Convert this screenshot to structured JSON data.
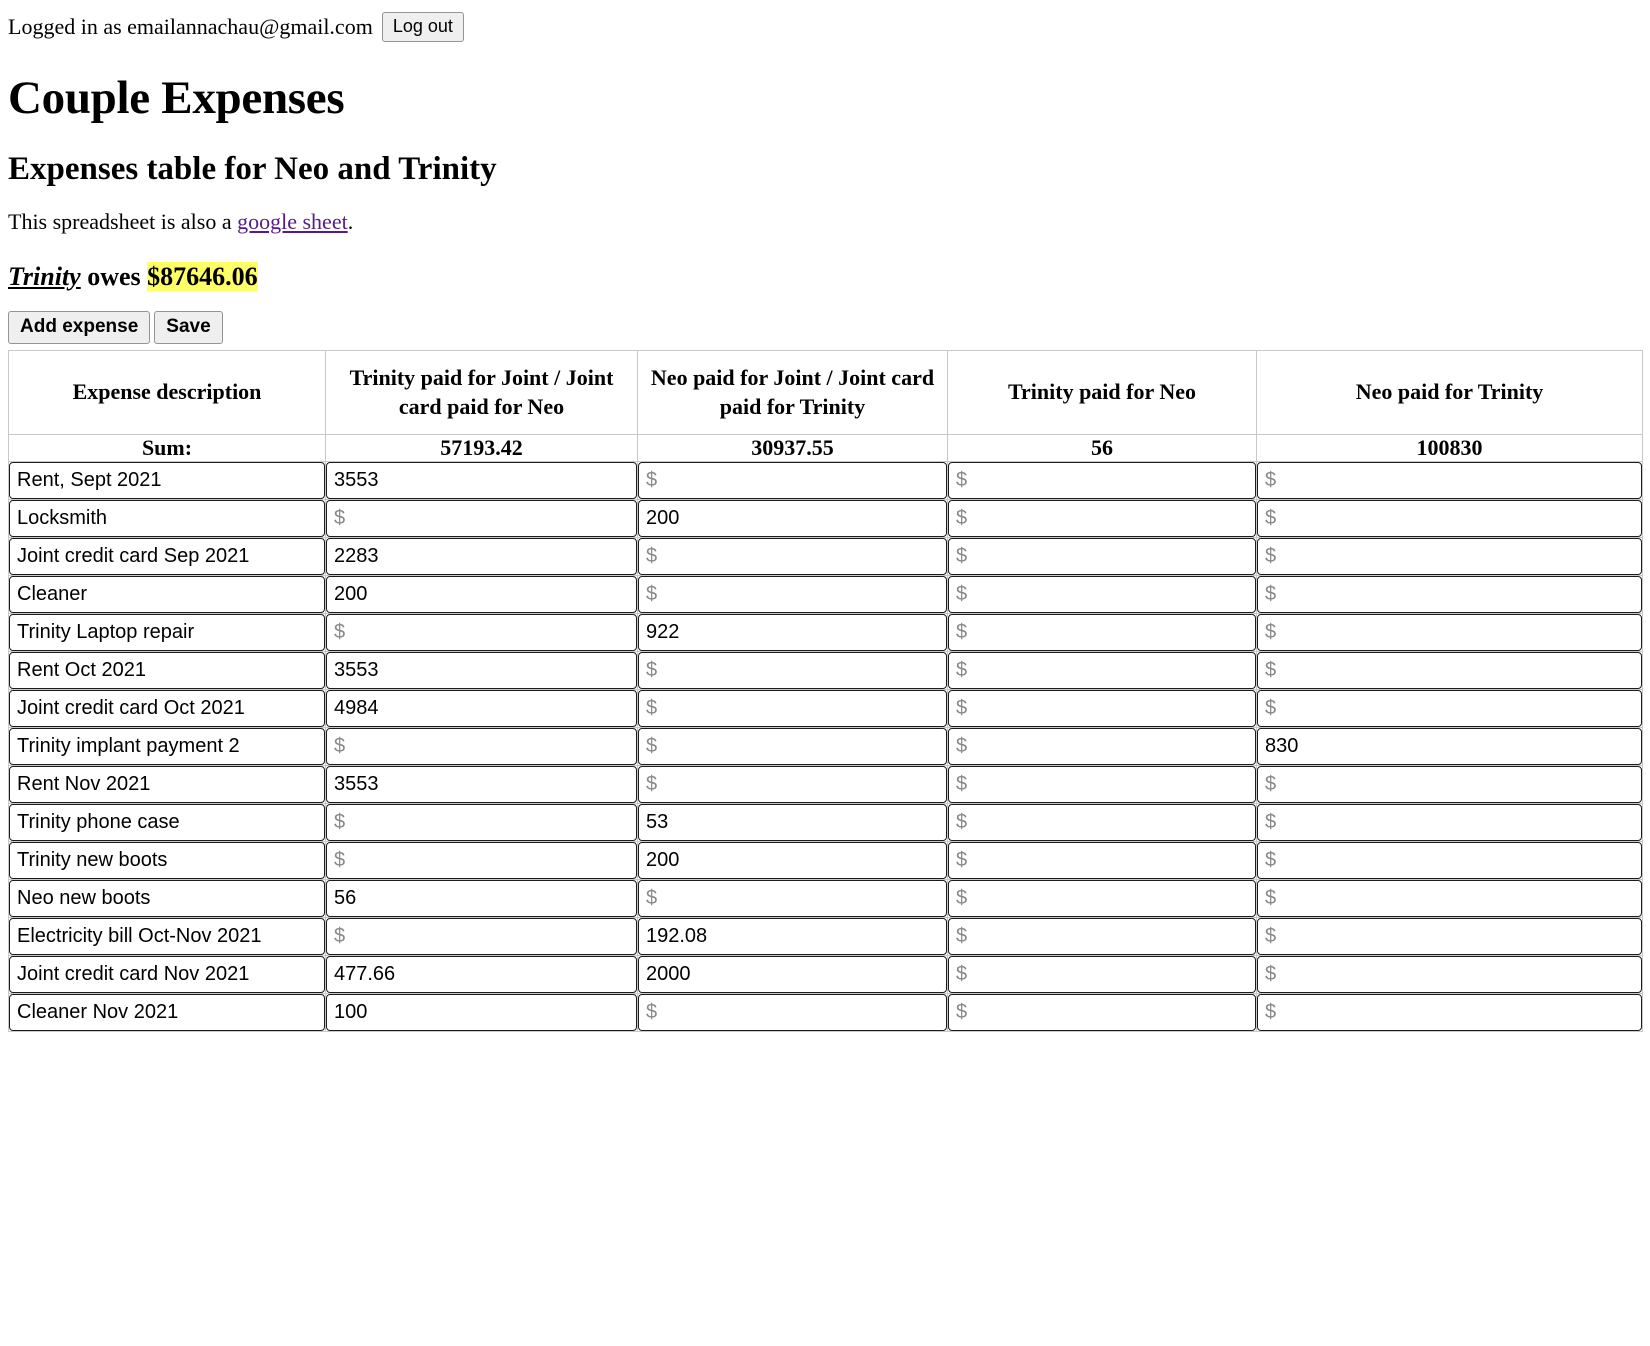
{
  "auth": {
    "logged_in_text": "Logged in as emailannachau@gmail.com",
    "logout_label": "Log out"
  },
  "header": {
    "title": "Couple Expenses",
    "subtitle": "Expenses table for Neo and Trinity"
  },
  "note": {
    "before": "This spreadsheet is also a ",
    "link_text": "google sheet",
    "after": "."
  },
  "balance": {
    "who": "Trinity",
    "verb": " owes ",
    "amount": "$87646.06",
    "highlight_color": "#ffff66"
  },
  "toolbar": {
    "add_label": "Add expense",
    "save_label": "Save"
  },
  "table": {
    "columns": [
      "Expense description",
      "Trinity paid for Joint / Joint card paid for Neo",
      "Neo paid for Joint / Joint card paid for Trinity",
      "Trinity paid for Neo",
      "Neo paid for Trinity"
    ],
    "sum_label": "Sum:",
    "sums": [
      "57193.42",
      "30937.55",
      "56",
      "100830"
    ],
    "amount_placeholder": "$",
    "rows": [
      {
        "description": "Rent, Sept 2021",
        "trinity_joint": "3553",
        "neo_joint": "",
        "trinity_for_neo": "",
        "neo_for_trinity": ""
      },
      {
        "description": "Locksmith",
        "trinity_joint": "",
        "neo_joint": "200",
        "trinity_for_neo": "",
        "neo_for_trinity": ""
      },
      {
        "description": "Joint credit card Sep 2021",
        "trinity_joint": "2283",
        "neo_joint": "",
        "trinity_for_neo": "",
        "neo_for_trinity": ""
      },
      {
        "description": "Cleaner",
        "trinity_joint": "200",
        "neo_joint": "",
        "trinity_for_neo": "",
        "neo_for_trinity": ""
      },
      {
        "description": "Trinity Laptop repair",
        "trinity_joint": "",
        "neo_joint": "922",
        "trinity_for_neo": "",
        "neo_for_trinity": ""
      },
      {
        "description": "Rent Oct 2021",
        "trinity_joint": "3553",
        "neo_joint": "",
        "trinity_for_neo": "",
        "neo_for_trinity": ""
      },
      {
        "description": "Joint credit card Oct 2021",
        "trinity_joint": "4984",
        "neo_joint": "",
        "trinity_for_neo": "",
        "neo_for_trinity": ""
      },
      {
        "description": "Trinity implant payment 2",
        "trinity_joint": "",
        "neo_joint": "",
        "trinity_for_neo": "",
        "neo_for_trinity": "830"
      },
      {
        "description": "Rent Nov 2021",
        "trinity_joint": "3553",
        "neo_joint": "",
        "trinity_for_neo": "",
        "neo_for_trinity": ""
      },
      {
        "description": "Trinity phone case",
        "trinity_joint": "",
        "neo_joint": "53",
        "trinity_for_neo": "",
        "neo_for_trinity": ""
      },
      {
        "description": "Trinity new boots",
        "trinity_joint": "",
        "neo_joint": "200",
        "trinity_for_neo": "",
        "neo_for_trinity": ""
      },
      {
        "description": "Neo new boots",
        "trinity_joint": "56",
        "neo_joint": "",
        "trinity_for_neo": "",
        "neo_for_trinity": ""
      },
      {
        "description": "Electricity bill Oct-Nov 2021",
        "trinity_joint": "",
        "neo_joint": "192.08",
        "trinity_for_neo": "",
        "neo_for_trinity": ""
      },
      {
        "description": "Joint credit card Nov 2021",
        "trinity_joint": "477.66",
        "neo_joint": "2000",
        "trinity_for_neo": "",
        "neo_for_trinity": ""
      },
      {
        "description": "Cleaner Nov 2021",
        "trinity_joint": "100",
        "neo_joint": "",
        "trinity_for_neo": "",
        "neo_for_trinity": ""
      }
    ]
  }
}
